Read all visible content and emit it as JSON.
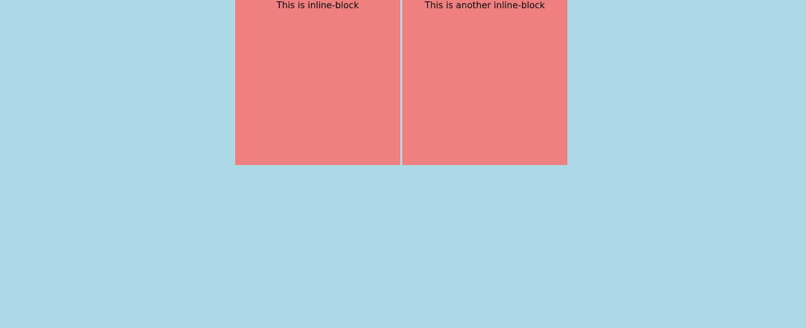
{
  "colors": {
    "background": "#add8e6",
    "box": "#f08080",
    "text": "#000000"
  },
  "boxes": [
    {
      "label": "This is inline-block"
    },
    {
      "label": "This is another inline-block"
    }
  ]
}
